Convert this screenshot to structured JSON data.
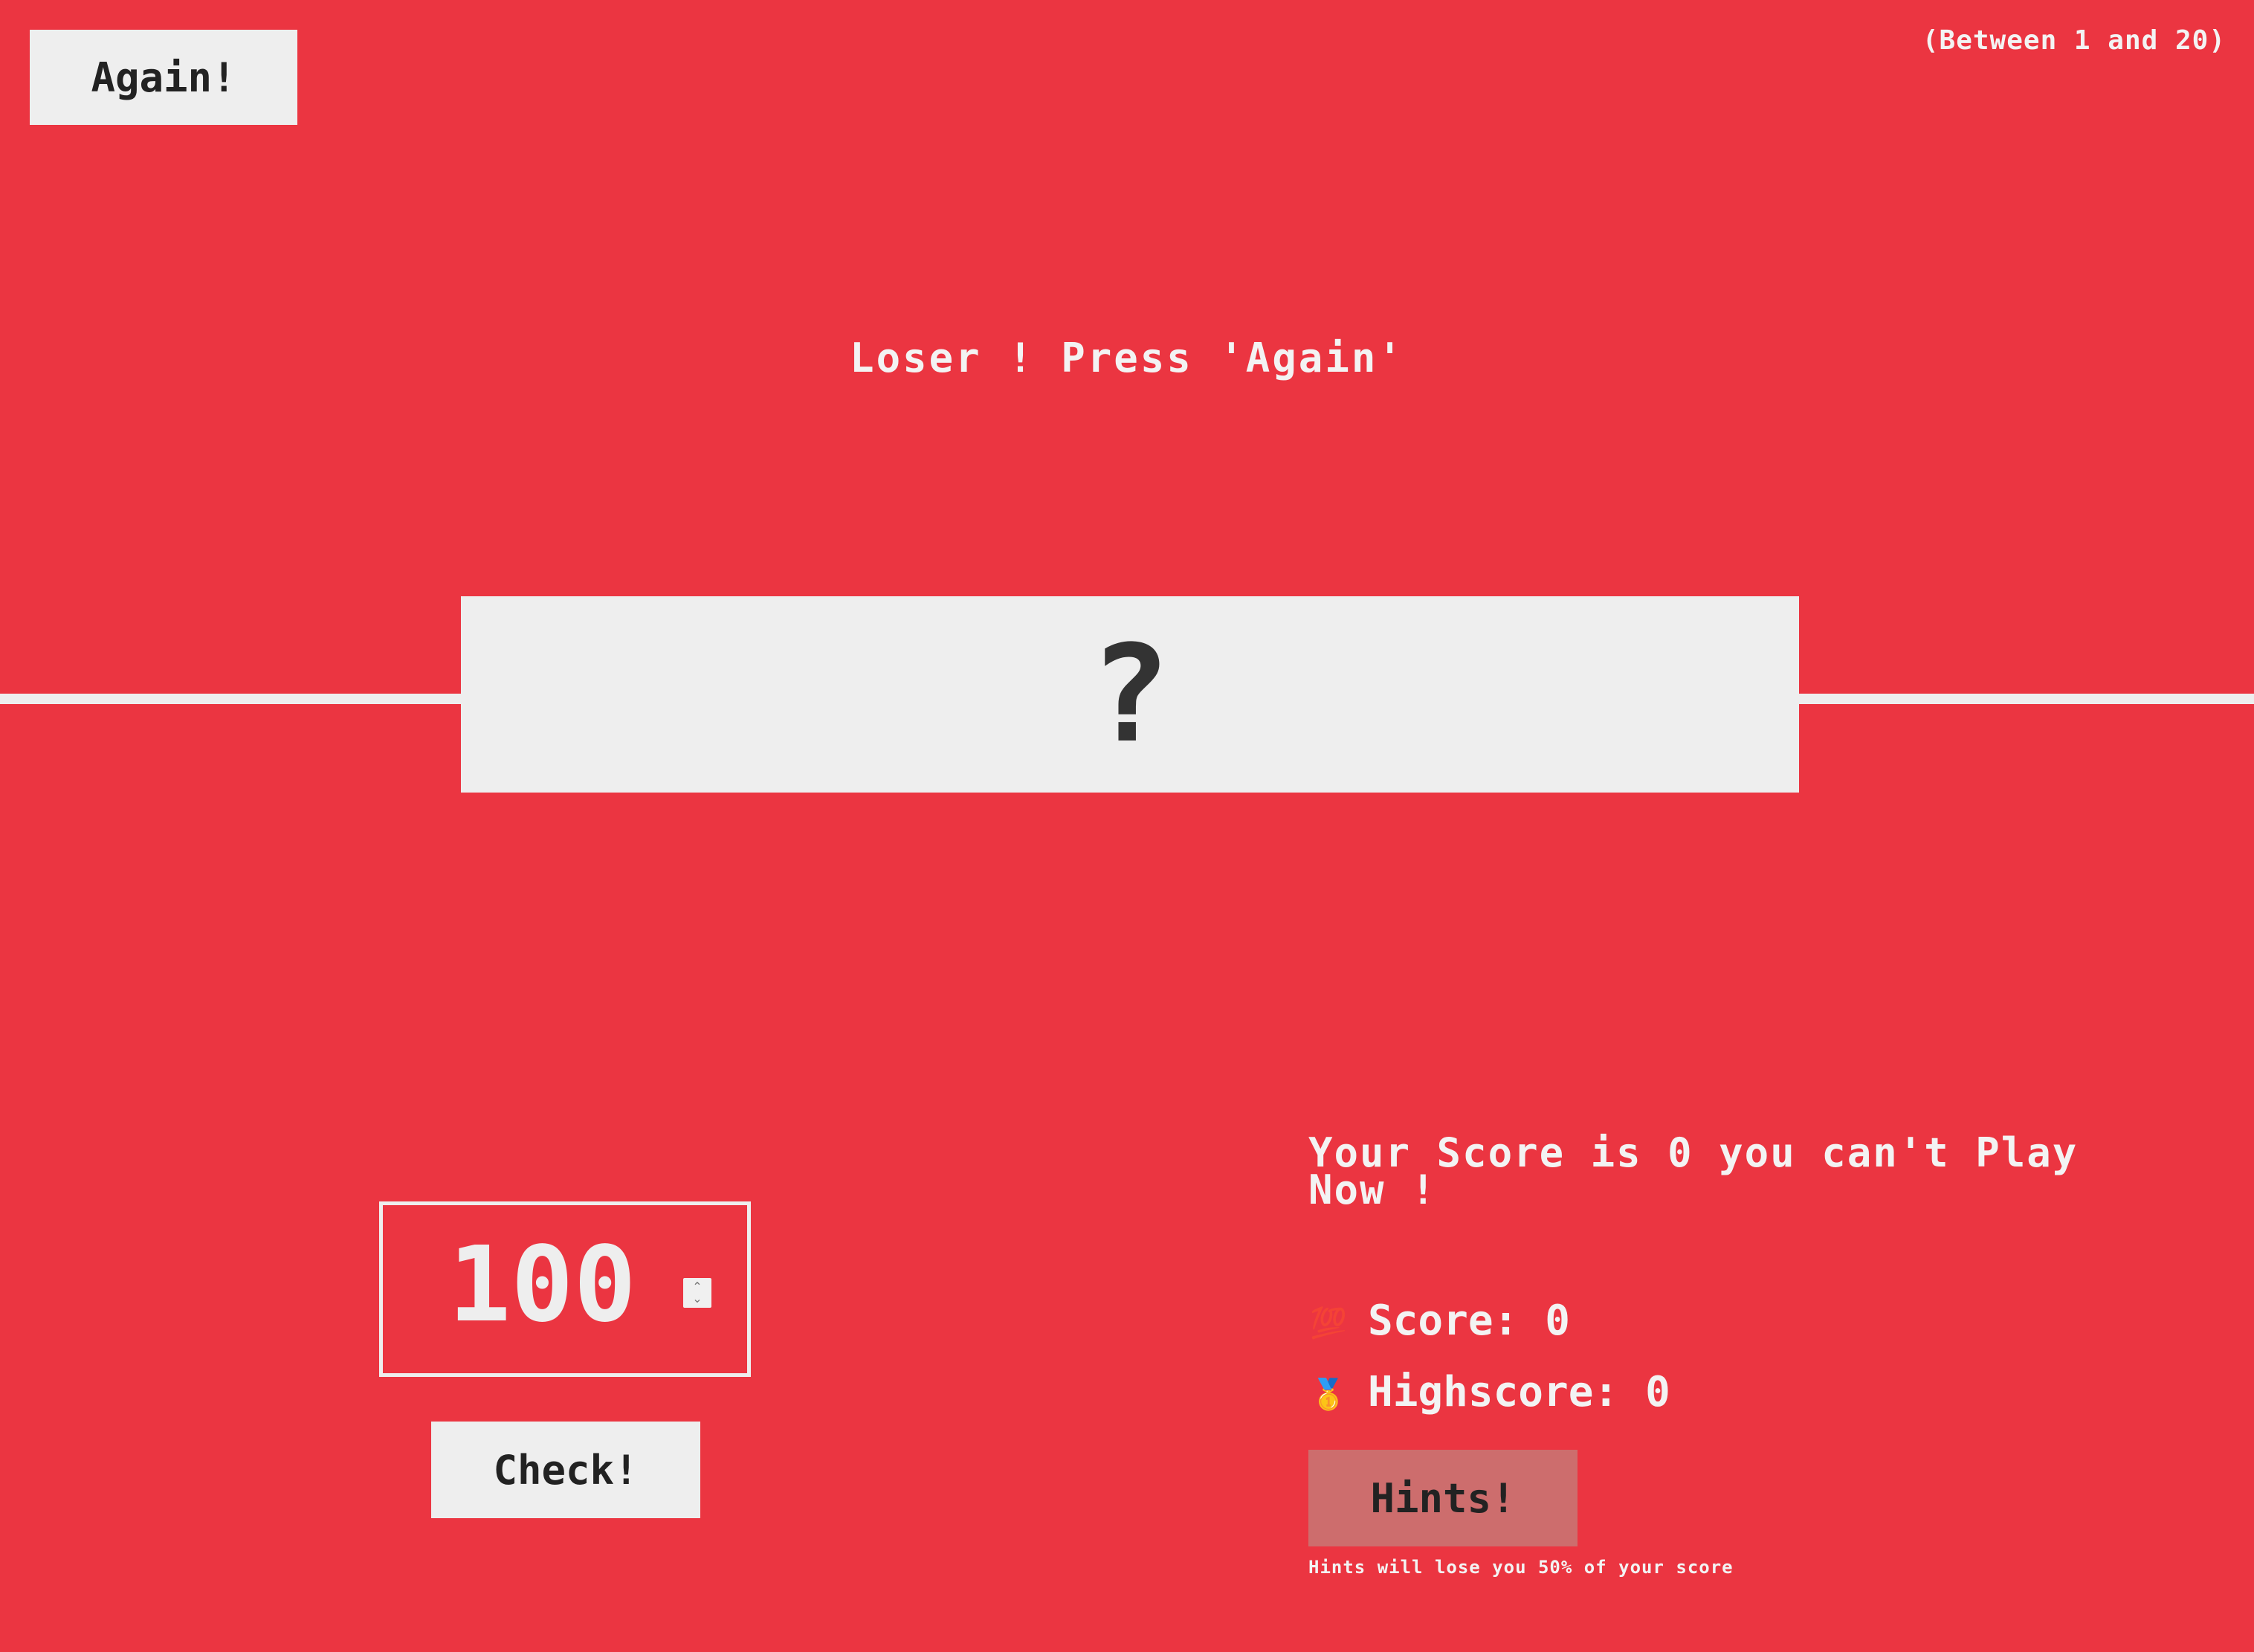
{
  "header": {
    "again_label": "Again!",
    "range_hint": "(Between 1 and 20)"
  },
  "game": {
    "message": "Loser ! Press 'Again'",
    "secret_number": "?",
    "guess_value": "100",
    "check_label": "Check!",
    "score_message": "Your Score is 0 you can't Play Now !"
  },
  "stats": {
    "score_icon": "💯",
    "score_label": "Score:",
    "score_value": "0",
    "highscore_icon": "🥇",
    "highscore_label": "Highscore:",
    "highscore_value": "0"
  },
  "hints": {
    "label": "Hints!",
    "note": "Hints will lose you 50% of your score"
  },
  "colors": {
    "background": "#eb3541",
    "panel": "#eeeeee",
    "hints_button": "#cd6d6d",
    "text_dark": "#333333"
  }
}
